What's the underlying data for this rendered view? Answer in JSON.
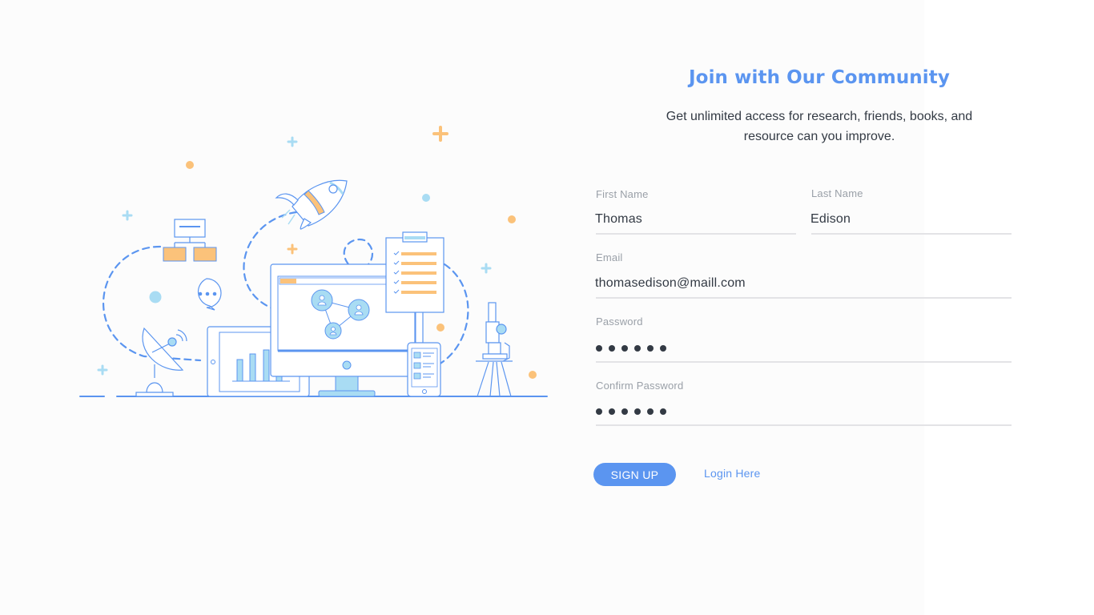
{
  "header": {
    "title": "Join with Our Community",
    "subtitle_line1": "Get unlimited access for research, friends, books, and",
    "subtitle_line2": "resource can you improve."
  },
  "form": {
    "first_name": {
      "label": "First Name",
      "value": "Thomas"
    },
    "last_name": {
      "label": "Last Name",
      "value": "Edison"
    },
    "email": {
      "label": "Email",
      "value": "thomasedison@maill.com"
    },
    "password": {
      "label": "Password",
      "masked_length": 6
    },
    "confirm_password": {
      "label": "Confirm Password",
      "masked_length": 6
    }
  },
  "actions": {
    "signup_label": "SIGN UP",
    "login_label": "Login Here"
  },
  "colors": {
    "accent": "#5b95f0",
    "illustration_blue": "#5b95f0",
    "illustration_light_blue": "#a9dcf3",
    "illustration_orange": "#fbc27a",
    "text_dark": "#333a44",
    "label_gray": "#9aa0a8"
  },
  "illustration": {
    "icons": [
      "rocket-icon",
      "satellite-dish-icon",
      "flowchart-icon",
      "chat-bubble-icon",
      "tablet-chart-icon",
      "monitor-network-icon",
      "clipboard-checklist-icon",
      "phone-list-icon",
      "microscope-icon"
    ]
  }
}
